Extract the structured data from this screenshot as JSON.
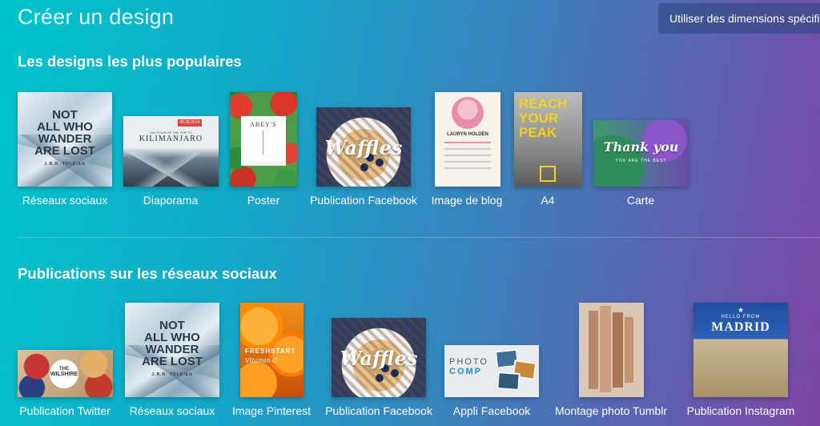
{
  "header": {
    "title": "Créer un design",
    "custom_dimensions_button": "Utiliser des dimensions spécifiques"
  },
  "popular": {
    "section_title": "Les designs les plus populaires",
    "items": [
      {
        "label": "Réseaux sociaux",
        "art": [
          "NOT",
          "ALL WHO",
          "WANDER",
          "ARE LOST",
          "J.R.R. TOLKIEN"
        ]
      },
      {
        "label": "Diaporama",
        "art": [
          "05.26.2014",
          "DAY FOUR OF THE TRIP TO",
          "KILIMANJARO"
        ]
      },
      {
        "label": "Poster",
        "art": [
          "ABEY'S"
        ]
      },
      {
        "label": "Publication Facebook",
        "art": [
          "Waffles"
        ]
      },
      {
        "label": "Image de blog",
        "art": [
          "LAURYN HOLDEN"
        ]
      },
      {
        "label": "A4",
        "art": [
          "REACH",
          "YOUR",
          "PEAK"
        ]
      },
      {
        "label": "Carte",
        "art": [
          "Thank you",
          "YOU ARE THE BEST"
        ]
      }
    ]
  },
  "social": {
    "section_title": "Publications sur les réseaux sociaux",
    "items": [
      {
        "label": "Publication Twitter",
        "art": [
          "THE",
          "WILSHIRE"
        ]
      },
      {
        "label": "Réseaux sociaux",
        "art": [
          "NOT",
          "ALL WHO",
          "WANDER",
          "ARE LOST",
          "J.R.R. TOLKIEN"
        ]
      },
      {
        "label": "Image Pinterest",
        "art": [
          "FRESHSTART",
          "Vitamin C"
        ]
      },
      {
        "label": "Publication Facebook",
        "art": [
          "Waffles"
        ]
      },
      {
        "label": "Appli Facebook",
        "art": [
          "PHOTO",
          "COMP"
        ]
      },
      {
        "label": "Montage photo Tumblr",
        "art": []
      },
      {
        "label": "Publication Instagram",
        "art": [
          "HELLO FROM",
          "MADRID"
        ]
      }
    ]
  },
  "colors": {
    "gradient_start": "#00c4cc",
    "gradient_end": "#7d45a6"
  }
}
